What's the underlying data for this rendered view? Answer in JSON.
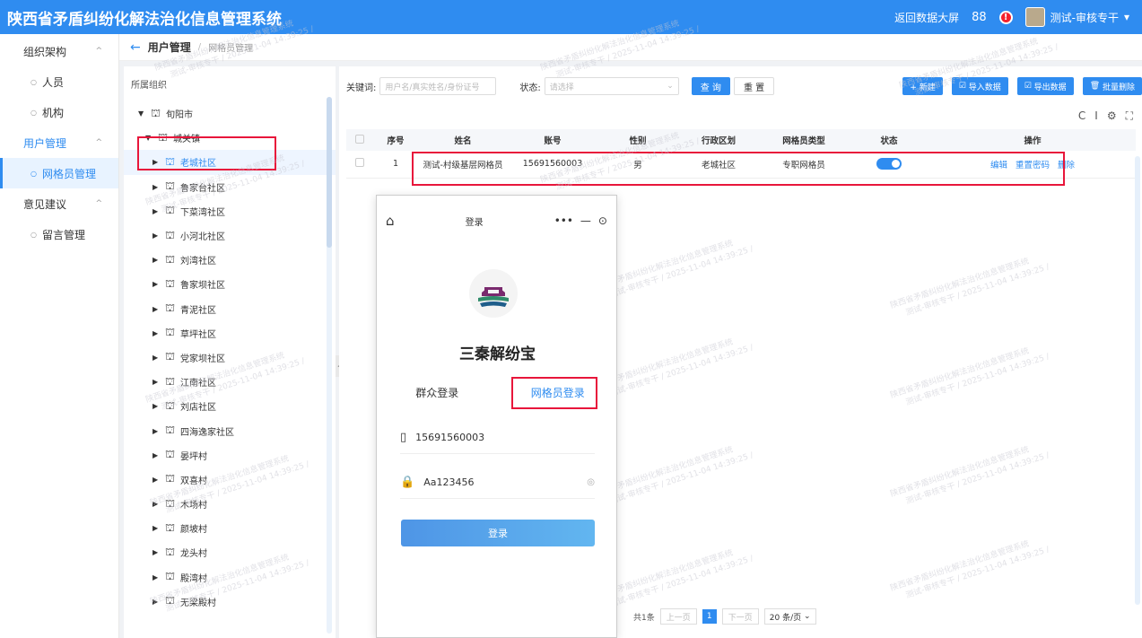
{
  "app": {
    "title": "陕西省矛盾纠纷化解法治化信息管理系统"
  },
  "topbar": {
    "big_screen": "返回数据大屏",
    "grid_icon": "88",
    "alert_icon": "!",
    "user": "测试-审核专干"
  },
  "sidebar": {
    "groups": [
      {
        "label": "组织架构",
        "caret": "^",
        "items": [
          "人员",
          "机构"
        ]
      },
      {
        "label": "用户管理",
        "caret": "^",
        "items": [
          "网格员管理"
        ]
      },
      {
        "label": "意见建议",
        "caret": "^",
        "items": [
          "留言管理"
        ]
      }
    ]
  },
  "breadcrumb": {
    "back": "←",
    "parent": "用户管理",
    "sep": "/",
    "current": "网格员管理"
  },
  "org_tree": {
    "title": "所属组织",
    "nodes": [
      "旬阳市",
      "城关镇",
      "老城社区",
      "鲁家台社区",
      "下菜湾社区",
      "小河北社区",
      "刘湾社区",
      "鲁家坝社区",
      "青泥社区",
      "草坪社区",
      "党家坝社区",
      "江南社区",
      "刘店社区",
      "四海逸家社区",
      "晏坪村",
      "双喜村",
      "木场村",
      "颜坡村",
      "龙头村",
      "殿湾村",
      "无梁殿村"
    ]
  },
  "filters": {
    "keyword_label": "关键词:",
    "keyword_placeholder": "用户名/真实姓名/身份证号",
    "status_label": "状态:",
    "status_placeholder": "请选择",
    "search": "查 询",
    "reset": "重 置"
  },
  "toolbar": {
    "add": "+ 新建",
    "import": "导入数据",
    "export": "导出数据",
    "batch_delete": "批量删除",
    "tools": [
      "C",
      "I",
      "⚙",
      "⛶"
    ]
  },
  "table": {
    "headers": [
      "序号",
      "姓名",
      "账号",
      "性别",
      "行政区划",
      "网格员类型",
      "状态",
      "操作"
    ],
    "rows": [
      {
        "index": "1",
        "name": "测试-村级基层网格员",
        "account": "15691560003",
        "gender": "男",
        "region": "老城社区",
        "type": "专职网格员",
        "status_on": true,
        "ops": [
          "编辑",
          "重置密码",
          "删除"
        ]
      }
    ]
  },
  "pager": {
    "total": "共1条",
    "prev": "上一页",
    "current": "1",
    "next": "下一页",
    "size": "20 条/页"
  },
  "phone": {
    "home_icon": "⌂",
    "title": "登录",
    "app_name": "三秦解纷宝",
    "tabs": [
      "群众登录",
      "网格员登录"
    ],
    "account": "15691560003",
    "password": "Aa123456",
    "login": "登录"
  },
  "watermark": {
    "line1": "陕西省矛盾纠纷化解法治化信息管理系统",
    "line2": "测试-审核专干 / 2025-11-04 14:39:25 /"
  }
}
